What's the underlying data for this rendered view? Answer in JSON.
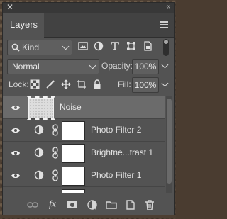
{
  "window": {
    "close_glyph": "✕",
    "collapse_glyph": "‹‹"
  },
  "panel": {
    "title": "Layers",
    "menu_icon": "hamburger-menu-icon"
  },
  "filter": {
    "kind_label": "Kind",
    "icons": [
      "search-icon",
      "image-filter-icon",
      "adjustment-filter-icon",
      "type-filter-icon",
      "shape-filter-icon",
      "smart-object-filter-icon"
    ]
  },
  "blend": {
    "mode": "Normal",
    "opacity_label": "Opacity:",
    "opacity_value": "100%"
  },
  "lock": {
    "label": "Lock:",
    "fill_label": "Fill:",
    "fill_value": "100%"
  },
  "layers": [
    {
      "name": "Noise",
      "type": "pixel",
      "visible": true,
      "selected": true
    },
    {
      "name": "Photo Filter 2",
      "type": "adjustment",
      "visible": true,
      "selected": false
    },
    {
      "name": "Brightne...trast 1",
      "type": "adjustment",
      "visible": true,
      "selected": false
    },
    {
      "name": "Photo Filter 1",
      "type": "adjustment",
      "visible": true,
      "selected": false
    }
  ],
  "footer": {
    "fx_label": "fx",
    "icons": [
      "link-icon",
      "fx-icon",
      "mask-icon",
      "adjustment-icon",
      "folder-icon",
      "new-layer-icon",
      "trash-icon"
    ]
  },
  "colors": {
    "panel_bg": "#535353",
    "selected_row": "#6b6b6b",
    "titlebar": "#383838"
  }
}
